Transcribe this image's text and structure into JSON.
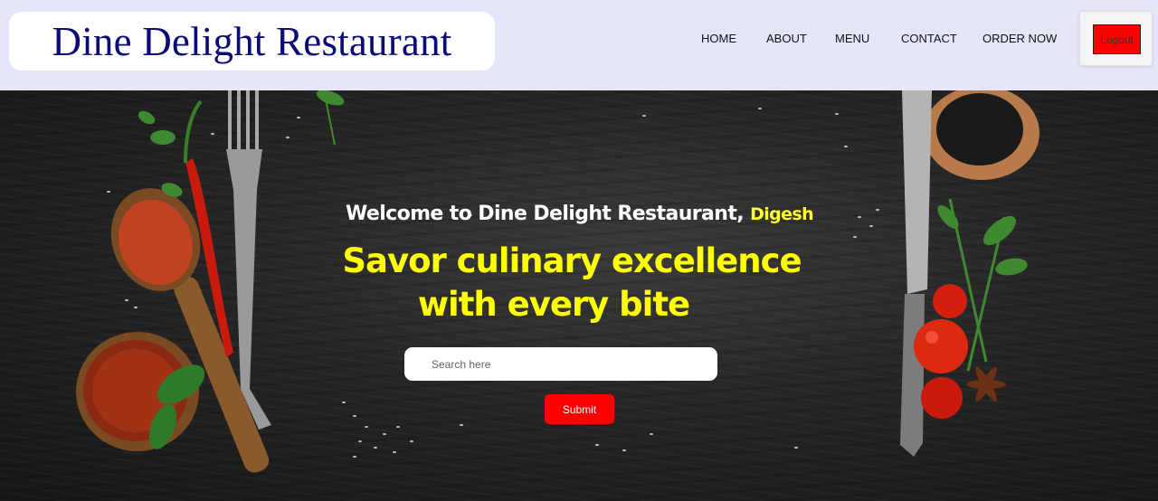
{
  "header": {
    "brand": "Dine Delight Restaurant",
    "nav": [
      "HOME",
      "ABOUT",
      "MENU",
      "CONTACT",
      "ORDER NOW"
    ],
    "logout_label": "Logout"
  },
  "hero": {
    "welcome_text": "Welcome to Dine Delight Restaurant, ",
    "username": "Digesh",
    "tagline_line1": "Savor culinary excellence",
    "tagline_line2": "with every bite",
    "search_placeholder": "Search here",
    "submit_label": "Submit"
  },
  "colors": {
    "header_bg": "#e6e6fa",
    "brand_text": "#0a0a78",
    "accent_red": "#ff0000",
    "tagline_yellow": "#ffff00"
  }
}
